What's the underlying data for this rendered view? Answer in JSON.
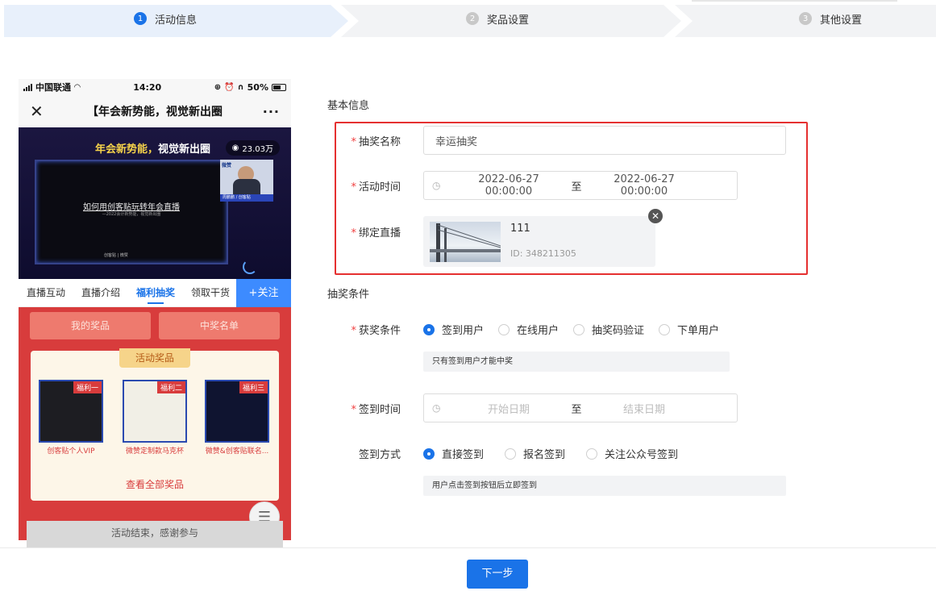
{
  "steps": [
    {
      "num": "1",
      "label": "活动信息"
    },
    {
      "num": "2",
      "label": "奖品设置"
    },
    {
      "num": "3",
      "label": "其他设置"
    }
  ],
  "phone": {
    "carrier": "中国联通",
    "time": "14:20",
    "battery": "50%",
    "title": "【年会新势能，视觉新出圈",
    "video": {
      "headline_a": "年会新势能，",
      "headline_b": "视觉",
      "headline_c": "新出圈",
      "viewers": "23.03万",
      "screen_title": "如何用创客贴玩转年会直播",
      "screen_sub": "—2022会计新势能，视觉新出圈",
      "screen_logos": "创客贴 | 微赞",
      "cam_logo": "微赞",
      "cam_caption": "周鹏鹏 / 创客贴"
    },
    "tabs": [
      "直播互动",
      "直播介绍",
      "福利抽奖",
      "领取干货"
    ],
    "active_tab": "福利抽奖",
    "follow": "+关注",
    "my_prizes": "我的奖品",
    "winners": "中奖名单",
    "prize_header": "活动奖品",
    "prizes": [
      {
        "tag": "福利一",
        "name": "创客贴个人VIP"
      },
      {
        "tag": "福利二",
        "name": "微赞定制款马克杯"
      },
      {
        "tag": "福利三",
        "name": "微赞&创客贴联名..."
      }
    ],
    "view_all": "查看全部奖品",
    "ended": "活动结束，感谢参与"
  },
  "form": {
    "basic_info": "基本信息",
    "lottery_name_label": "抽奖名称",
    "lottery_name_value": "幸运抽奖",
    "time_label": "活动时间",
    "time_start": "2022-06-27 00:00:00",
    "time_sep": "至",
    "time_end": "2022-06-27 00:00:00",
    "live_label": "绑定直播",
    "live_name": "111",
    "live_id": "ID:  348211305",
    "conditions_title": "抽奖条件",
    "win_cond_label": "获奖条件",
    "win_cond_options": [
      "签到用户",
      "在线用户",
      "抽奖码验证",
      "下单用户"
    ],
    "win_cond_selected": "签到用户",
    "win_cond_hint": "只有签到用户才能中奖",
    "signin_time_label": "签到时间",
    "signin_start_ph": "开始日期",
    "signin_sep": "至",
    "signin_end_ph": "结束日期",
    "signin_method_label": "签到方式",
    "signin_method_options": [
      "直接签到",
      "报名签到",
      "关注公众号签到"
    ],
    "signin_method_selected": "直接签到",
    "signin_method_hint": "用户点击签到按钮后立即签到",
    "next": "下一步"
  },
  "colors": {
    "accent": "#1a73e8",
    "required": "#f04040",
    "highlight_border": "#e53030",
    "phone_red": "#d83c3c"
  }
}
